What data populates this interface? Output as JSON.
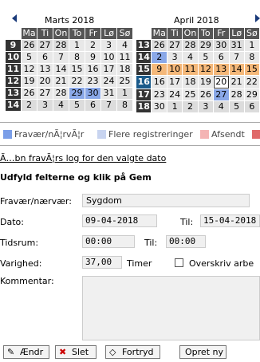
{
  "calendars": [
    {
      "title": "Marts 2018",
      "dow": [
        "Ma",
        "Ti",
        "On",
        "To",
        "Fr",
        "Lø",
        "Sø"
      ],
      "weeks": [
        {
          "wk": "9",
          "days": [
            [
              "26",
              "other"
            ],
            [
              "27",
              "other"
            ],
            [
              "28",
              "other"
            ],
            [
              "1",
              ""
            ],
            [
              "2",
              ""
            ],
            [
              "3",
              ""
            ],
            [
              "4",
              ""
            ]
          ]
        },
        {
          "wk": "10",
          "days": [
            [
              "5",
              ""
            ],
            [
              "6",
              ""
            ],
            [
              "7",
              ""
            ],
            [
              "8",
              ""
            ],
            [
              "9",
              ""
            ],
            [
              "10",
              ""
            ],
            [
              "11",
              ""
            ]
          ]
        },
        {
          "wk": "11",
          "days": [
            [
              "12",
              ""
            ],
            [
              "13",
              ""
            ],
            [
              "14",
              ""
            ],
            [
              "15",
              ""
            ],
            [
              "16",
              ""
            ],
            [
              "17",
              ""
            ],
            [
              "18",
              ""
            ]
          ]
        },
        {
          "wk": "12",
          "days": [
            [
              "19",
              ""
            ],
            [
              "20",
              ""
            ],
            [
              "21",
              ""
            ],
            [
              "22",
              ""
            ],
            [
              "23",
              ""
            ],
            [
              "24",
              ""
            ],
            [
              "25",
              ""
            ]
          ]
        },
        {
          "wk": "13",
          "days": [
            [
              "26",
              ""
            ],
            [
              "27",
              ""
            ],
            [
              "28",
              ""
            ],
            [
              "29",
              "blue"
            ],
            [
              "30",
              "blue"
            ],
            [
              "31",
              ""
            ],
            [
              "1",
              "other"
            ]
          ]
        },
        {
          "wk": "14",
          "days": [
            [
              "2",
              "other"
            ],
            [
              "3",
              "other"
            ],
            [
              "4",
              "other"
            ],
            [
              "5",
              "other"
            ],
            [
              "6",
              "other"
            ],
            [
              "7",
              "other"
            ],
            [
              "8",
              "other"
            ]
          ]
        }
      ]
    },
    {
      "title": "April 2018",
      "dow": [
        "Ma",
        "Ti",
        "On",
        "To",
        "Fr",
        "Lø",
        "Sø"
      ],
      "weeks": [
        {
          "wk": "13",
          "days": [
            [
              "26",
              "other"
            ],
            [
              "27",
              "other"
            ],
            [
              "28",
              "other"
            ],
            [
              "29",
              "other"
            ],
            [
              "30",
              "other"
            ],
            [
              "31",
              "other"
            ],
            [
              "1",
              ""
            ]
          ]
        },
        {
          "wk": "14",
          "days": [
            [
              "2",
              "blue"
            ],
            [
              "3",
              ""
            ],
            [
              "4",
              ""
            ],
            [
              "5",
              ""
            ],
            [
              "6",
              ""
            ],
            [
              "7",
              ""
            ],
            [
              "8",
              ""
            ]
          ]
        },
        {
          "wk": "15",
          "days": [
            [
              "9",
              "orange"
            ],
            [
              "10",
              "orange"
            ],
            [
              "11",
              "orange"
            ],
            [
              "12",
              "orange"
            ],
            [
              "13",
              "orange"
            ],
            [
              "14",
              "orange"
            ],
            [
              "15",
              "orange"
            ]
          ]
        },
        {
          "wk": "16",
          "days": [
            [
              "16",
              ""
            ],
            [
              "17",
              ""
            ],
            [
              "18",
              ""
            ],
            [
              "19",
              ""
            ],
            [
              "20",
              "today"
            ],
            [
              "21",
              ""
            ],
            [
              "22",
              ""
            ]
          ],
          "highlight": true
        },
        {
          "wk": "17",
          "days": [
            [
              "23",
              ""
            ],
            [
              "24",
              ""
            ],
            [
              "25",
              ""
            ],
            [
              "26",
              ""
            ],
            [
              "27",
              "blue"
            ],
            [
              "28",
              ""
            ],
            [
              "29",
              ""
            ]
          ]
        },
        {
          "wk": "18",
          "days": [
            [
              "30",
              ""
            ],
            [
              "1",
              "other"
            ],
            [
              "2",
              "other"
            ],
            [
              "3",
              "other"
            ],
            [
              "4",
              "other"
            ],
            [
              "5",
              "other"
            ],
            [
              "6",
              "other"
            ]
          ]
        }
      ]
    }
  ],
  "legend": [
    {
      "label": "Fravær/nÃ¦rvÃ¦r",
      "color": "#7a9ee8"
    },
    {
      "label": "Flere registreringer",
      "color": "#c8d4f0"
    },
    {
      "label": "Afsendt",
      "color": "#f4b4b4"
    },
    {
      "label": "",
      "color": "#e06a6a"
    }
  ],
  "log_link": "Ã…bn fravÃ¦rs log for den valgte dato",
  "section_title": "Udfyld felterne og klik på Gem",
  "form": {
    "type_label": "Fravær/nærvær:",
    "type_value": "Sygdom",
    "date_label": "Dato:",
    "date_from": "09-04-2018",
    "date_to_label": "Til:",
    "date_to": "15-04-2018",
    "time_label": "Tidsrum:",
    "time_from": "00:00",
    "time_to_label": "Til:",
    "time_to": "00:00",
    "duration_label": "Varighed:",
    "duration_value": "37,00",
    "duration_unit": "Timer",
    "overwrite_label": "Overskriv arbe",
    "comment_label": "Kommentar:"
  },
  "buttons": {
    "edit": "Ændr",
    "delete": "Slet",
    "undo": "Fortryd",
    "create": "Opret ny"
  }
}
